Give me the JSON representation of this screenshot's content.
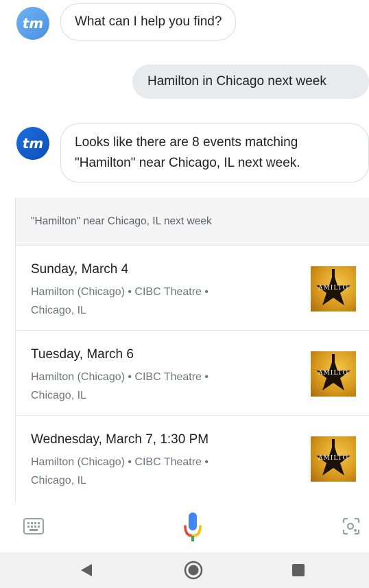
{
  "conversation": {
    "assistant_avatar": "tm",
    "greeting": "What can I help you find?",
    "user_query": "Hamilton in Chicago next week",
    "response_line1": "Looks like there are 8 events matching",
    "response_line2": "\"Hamilton\" near Chicago, IL next week."
  },
  "results": {
    "header": "\"Hamilton\" near Chicago, IL next week",
    "events": [
      {
        "date": "Sunday, March 4",
        "meta_line1": "Hamilton (Chicago) • CIBC Theatre •",
        "meta_line2": "Chicago, IL",
        "thumb_text": "AMILTO"
      },
      {
        "date": "Tuesday, March 6",
        "meta_line1": "Hamilton (Chicago) • CIBC Theatre •",
        "meta_line2": "Chicago, IL",
        "thumb_text": "AMILTO"
      },
      {
        "date": "Wednesday, March 7, 1:30 PM",
        "meta_line1": "Hamilton (Chicago) • CIBC Theatre •",
        "meta_line2": "Chicago, IL",
        "thumb_text": "AMILTO"
      }
    ]
  },
  "input_bar": {
    "left_icon": "keyboard-icon",
    "center_icon": "microphone-icon",
    "right_icon": "lens-icon"
  },
  "navigation": {
    "back_icon": "back-triangle-icon",
    "home_icon": "home-circle-icon",
    "recents_icon": "recents-square-icon"
  },
  "colors": {
    "user_bubble": "#e8eaed",
    "accent_blue": "#4285f4",
    "accent_red": "#ea4335",
    "accent_yellow": "#fbbc05",
    "accent_green": "#34a853"
  }
}
